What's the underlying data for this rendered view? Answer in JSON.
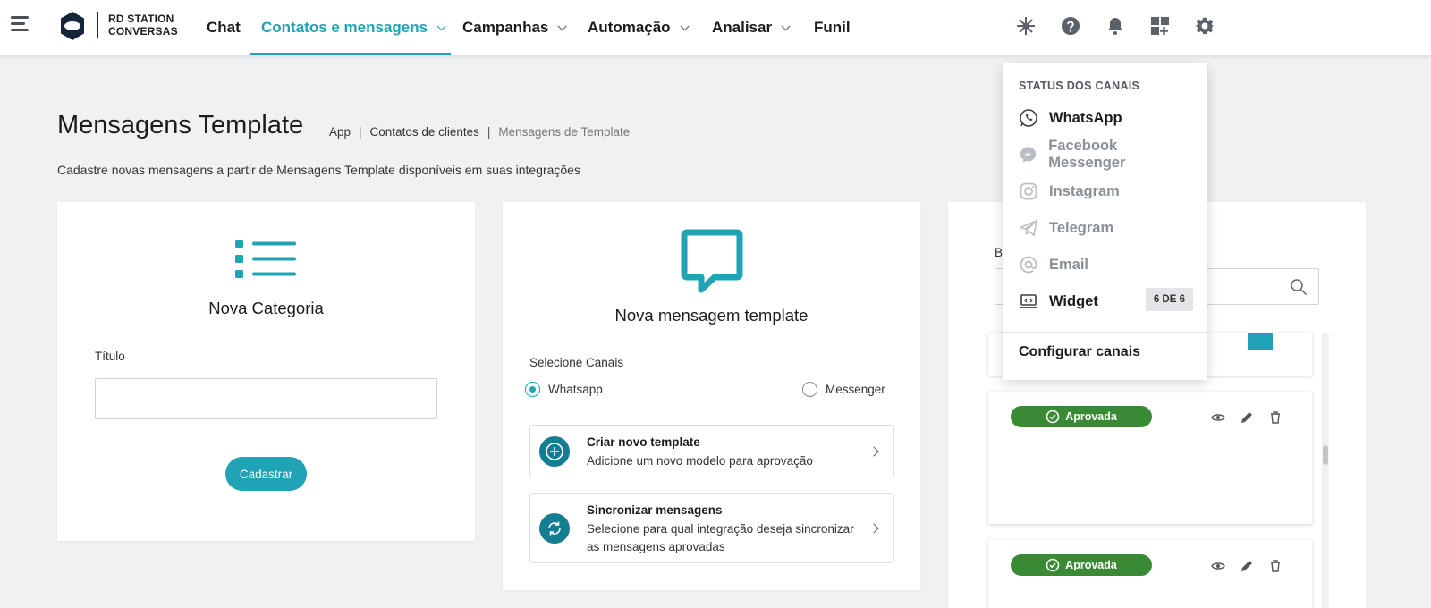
{
  "nav": {
    "logo_line1": "RD STATION",
    "logo_line2": "CONVERSAS",
    "items": [
      {
        "label": "Chat"
      },
      {
        "label": "Contatos e mensagens"
      },
      {
        "label": "Campanhas"
      },
      {
        "label": "Automação"
      },
      {
        "label": "Analisar"
      },
      {
        "label": "Funil"
      }
    ],
    "icons": [
      "integrations-icon",
      "help-icon",
      "bell-icon",
      "apps-add-icon",
      "gear-icon"
    ],
    "accent": "#1fa3b5"
  },
  "header": {
    "title": "Mensagens Template",
    "breadcrumb": [
      "App",
      "Contatos de clientes",
      "Mensagens de Template"
    ],
    "subtitle": "Cadastre novas mensagens a partir de Mensagens Template disponíveis em suas integrações"
  },
  "category_card": {
    "title": "Nova Categoria",
    "field_label": "Título",
    "field_value": "",
    "submit_label": "Cadastrar"
  },
  "template_card": {
    "title": "Nova mensagem template",
    "channels_label": "Selecione Canais",
    "channels": [
      {
        "label": "Whatsapp",
        "checked": true
      },
      {
        "label": "Messenger",
        "checked": false
      }
    ],
    "options": [
      {
        "title": "Criar novo template",
        "description": "Adicione um novo modelo para aprovação"
      },
      {
        "title": "Sincronizar mensagens",
        "description": "Selecione para qual integração deseja sincronizar as mensagens aprovadas"
      }
    ]
  },
  "list_card": {
    "search_label_visible": "B",
    "search_value": "",
    "templates": [
      {
        "status": "Aprovada",
        "status_color": "#3a8a35"
      },
      {
        "status": "Aprovada",
        "status_color": "#3a8a35"
      }
    ]
  },
  "channel_status": {
    "heading": "STATUS DOS CANAIS",
    "channels": [
      {
        "label": "WhatsApp",
        "icon": "whatsapp-icon",
        "active": true
      },
      {
        "label": "Facebook Messenger",
        "icon": "messenger-icon",
        "active": false
      },
      {
        "label": "Instagram",
        "icon": "instagram-icon",
        "active": false
      },
      {
        "label": "Telegram",
        "icon": "telegram-icon",
        "active": false
      },
      {
        "label": "Email",
        "icon": "at-icon",
        "active": false
      },
      {
        "label": "Widget",
        "icon": "widget-icon",
        "active": true
      }
    ],
    "widget_count": "6 DE 6",
    "configure_label": "Configurar canais"
  }
}
